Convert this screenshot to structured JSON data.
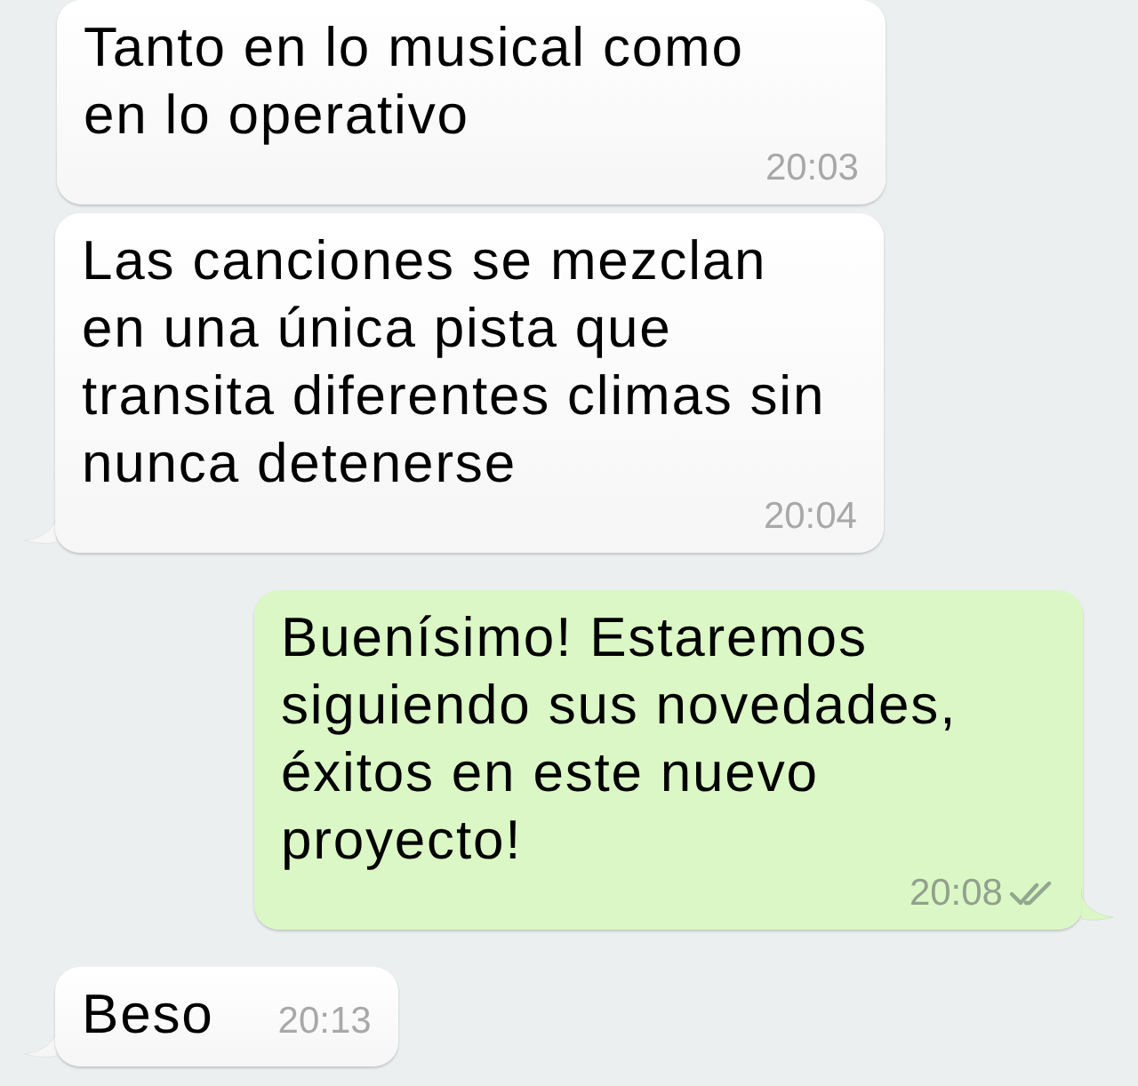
{
  "messages": [
    {
      "kind": "incoming",
      "text": "Tanto en lo musical como\nen lo operativo",
      "time": "20:03",
      "tail": false
    },
    {
      "kind": "incoming",
      "text": "Las canciones se mezclan\nen una única pista que\ntransita diferentes climas sin\nnunca detenerse",
      "time": "20:04",
      "tail": true
    },
    {
      "kind": "outgoing",
      "text": "Buenísimo! Estaremos\nsiguiendo sus novedades,\néxitos en este nuevo\nproyecto!",
      "time": "20:08",
      "tail": true,
      "delivered": true
    },
    {
      "kind": "incoming",
      "text": "Beso",
      "time": "20:13",
      "tail": true
    }
  ]
}
